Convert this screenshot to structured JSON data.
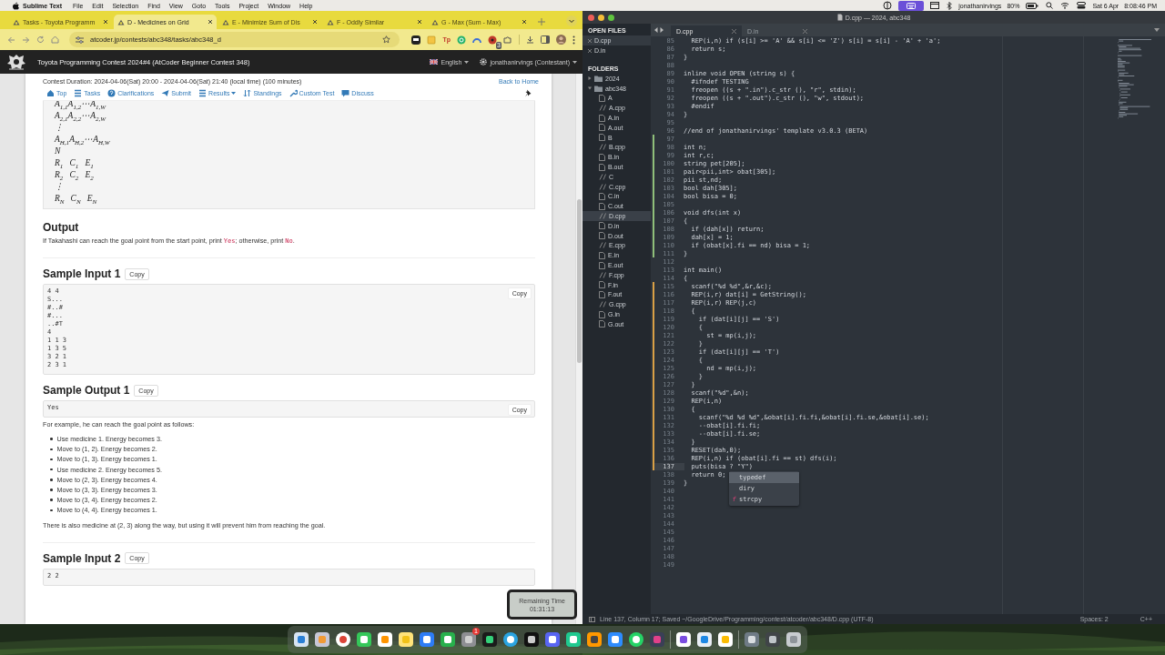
{
  "menubar": {
    "app": "Sublime Text",
    "menus": [
      "File",
      "Edit",
      "Selection",
      "Find",
      "View",
      "Goto",
      "Tools",
      "Project",
      "Window",
      "Help"
    ],
    "user": "jonathanirvings",
    "battery": "80%",
    "date": "Sat 6 Apr",
    "time": "8:08:46 PM"
  },
  "browser": {
    "tabs": [
      {
        "title": "Tasks - Toyota Programm",
        "selected": false
      },
      {
        "title": "D - Medicines on Grid",
        "selected": true
      },
      {
        "title": "E - Minimize Sum of Dis",
        "selected": false
      },
      {
        "title": "F - Oddly Similar",
        "selected": false
      },
      {
        "title": "G - Max (Sum - Max)",
        "selected": false
      }
    ],
    "url": "atcoder.jp/contests/abc348/tasks/abc348_d",
    "extension_label": "Tp",
    "extension_badge": "3",
    "site": {
      "title": "Toyota Programming Contest 2024#4 (AtCoder Beginner Contest 348)",
      "language": "English",
      "user": "jonathanirvings (Contestant)"
    },
    "contest_duration": "Contest Duration: 2024-04-06(Sat) 20:00 - 2024-04-06(Sat) 21:40 (local time) (100 minutes)",
    "back_link": "Back to Home",
    "nav": [
      {
        "label": "Top",
        "kind": "home",
        "dropdown": false
      },
      {
        "label": "Tasks",
        "kind": "list",
        "dropdown": false
      },
      {
        "label": "Clarifications",
        "kind": "question",
        "dropdown": false
      },
      {
        "label": "Submit",
        "kind": "send",
        "dropdown": false
      },
      {
        "label": "Results",
        "kind": "list",
        "dropdown": true
      },
      {
        "label": "Standings",
        "kind": "sort",
        "dropdown": false
      },
      {
        "label": "Custom Test",
        "kind": "wrench",
        "dropdown": false
      },
      {
        "label": "Discuss",
        "kind": "comment",
        "dropdown": false
      }
    ],
    "input_format": [
      "A$_{1,1}$A$_{1,2}$⋯A$_{1,W}$",
      "A$_{2,1}$A$_{2,2}$⋯A$_{2,W}$",
      "⋮",
      "A$_{H,1}$A$_{H,2}$⋯A$_{H,W}$",
      "N",
      "R$_{1}$   C$_{1}$   E$_{1}$",
      "R$_{2}$   C$_{2}$   E$_{2}$",
      "⋮",
      "R$_{N}$   C$_{N}$   E$_{N}$"
    ],
    "sections": [
      {
        "kind": "heading",
        "text": "Output"
      },
      {
        "kind": "paragraph",
        "segments": [
          {
            "text": "If Takahashi can reach the goal point from the start point, print "
          },
          {
            "text": "Yes",
            "kind": "code"
          },
          {
            "text": "; otherwise, print "
          },
          {
            "text": "No",
            "kind": "code"
          },
          {
            "text": "."
          }
        ]
      },
      {
        "kind": "rule"
      },
      {
        "kind": "sample",
        "title": "Sample Input 1",
        "copy": "Copy",
        "box_copy": "Copy",
        "lines": [
          "4 4",
          "S...",
          "#..#",
          "#...",
          "..#T",
          "4",
          "1 1 3",
          "1 3 5",
          "3 2 1",
          "2 3 1"
        ]
      },
      {
        "kind": "sample",
        "title": "Sample Output 1",
        "copy": "Copy",
        "box_copy": "Copy",
        "lines": [
          "Yes"
        ]
      },
      {
        "kind": "paragraph",
        "segments": [
          {
            "text": "For example, he can reach the goal point as follows:"
          }
        ]
      },
      {
        "kind": "list",
        "items": [
          "Use medicine 1. Energy becomes 3.",
          "Move to (1, 2). Energy becomes 2.",
          "Move to (1, 3). Energy becomes 1.",
          "Use medicine 2. Energy becomes 5.",
          "Move to (2, 3). Energy becomes 4.",
          "Move to (3, 3). Energy becomes 3.",
          "Move to (3, 4). Energy becomes 2.",
          "Move to (4, 4). Energy becomes 1."
        ]
      },
      {
        "kind": "paragraph",
        "segments": [
          {
            "text": "There is also medicine at (2, 3) along the way, but using it will prevent him from reaching the goal."
          }
        ]
      },
      {
        "kind": "rule"
      },
      {
        "kind": "sample",
        "title": "Sample Input 2",
        "copy": "Copy",
        "lines": [
          "2 2"
        ]
      }
    ]
  },
  "timer": {
    "label": "Remaining Time",
    "value": "01:31:13"
  },
  "editor": {
    "title": "D.cpp — 2024, abc348",
    "open_files_header": "OPEN FILES",
    "folders_header": "FOLDERS",
    "open_files": [
      {
        "name": "D.cpp",
        "selected": true
      },
      {
        "name": "D.in",
        "selected": false
      }
    ],
    "folders": [
      {
        "name": "2024",
        "expanded": false
      },
      {
        "name": "abc348",
        "expanded": true,
        "children": [
          {
            "name": "A",
            "kind": "file",
            "selected": false
          },
          {
            "name": "A.cpp",
            "kind": "source",
            "selected": false
          },
          {
            "name": "A.in",
            "kind": "file",
            "selected": false
          },
          {
            "name": "A.out",
            "kind": "file",
            "selected": false
          },
          {
            "name": "B",
            "kind": "file",
            "selected": false
          },
          {
            "name": "B.cpp",
            "kind": "source",
            "selected": false
          },
          {
            "name": "B.in",
            "kind": "file",
            "selected": false
          },
          {
            "name": "B.out",
            "kind": "file",
            "selected": false
          },
          {
            "name": "C",
            "kind": "source",
            "selected": false
          },
          {
            "name": "C.cpp",
            "kind": "source",
            "selected": false
          },
          {
            "name": "C.in",
            "kind": "file",
            "selected": false
          },
          {
            "name": "C.out",
            "kind": "file",
            "selected": false
          },
          {
            "name": "D.cpp",
            "kind": "source",
            "selected": true
          },
          {
            "name": "D.in",
            "kind": "file",
            "selected": false
          },
          {
            "name": "D.out",
            "kind": "file",
            "selected": false
          },
          {
            "name": "E.cpp",
            "kind": "source",
            "selected": false
          },
          {
            "name": "E.in",
            "kind": "file",
            "selected": false
          },
          {
            "name": "E.out",
            "kind": "file",
            "selected": false
          },
          {
            "name": "F.cpp",
            "kind": "source",
            "selected": false
          },
          {
            "name": "F.in",
            "kind": "file",
            "selected": false
          },
          {
            "name": "F.out",
            "kind": "file",
            "selected": false
          },
          {
            "name": "G.cpp",
            "kind": "source",
            "selected": false
          },
          {
            "name": "G.in",
            "kind": "file",
            "selected": false
          },
          {
            "name": "G.out",
            "kind": "file",
            "selected": false
          }
        ]
      }
    ],
    "tabs": [
      {
        "name": "D.cpp",
        "selected": true
      },
      {
        "name": "D.in",
        "selected": false
      }
    ],
    "lines": [
      {
        "n": "85",
        "text": "  REP(i,n) if (s[i] >= 'A' && s[i] <= 'Z') s[i] = s[i] - 'A' + 'a';",
        "current": false
      },
      {
        "n": "86",
        "text": "  return s;",
        "current": false
      },
      {
        "n": "87",
        "text": "}",
        "current": false
      },
      {
        "n": "88",
        "current": false
      },
      {
        "n": "89",
        "text": "inline void OPEN (string s) {",
        "current": false
      },
      {
        "n": "90",
        "text": "  #ifndef TESTING",
        "current": false
      },
      {
        "n": "91",
        "text": "  freopen ((s + \".in\").c_str (), \"r\", stdin);",
        "current": false
      },
      {
        "n": "92",
        "text": "  freopen ((s + \".out\").c_str (), \"w\", stdout);",
        "current": false
      },
      {
        "n": "93",
        "text": "  #endif",
        "current": false
      },
      {
        "n": "94",
        "text": "}",
        "current": false
      },
      {
        "n": "95",
        "current": false
      },
      {
        "n": "96",
        "text": "//end of jonathanirvings' template v3.0.3 (BETA)",
        "current": false
      },
      {
        "n": "97",
        "current": false,
        "color": "#8fbf7a"
      },
      {
        "n": "98",
        "text": "int n;",
        "current": false,
        "color": "#8fbf7a"
      },
      {
        "n": "99",
        "text": "int r,c;",
        "current": false,
        "color": "#8fbf7a"
      },
      {
        "n": "100",
        "text": "string pet[205];",
        "current": false,
        "color": "#8fbf7a"
      },
      {
        "n": "101",
        "text": "pair<pii,int> obat[305];",
        "current": false,
        "color": "#8fbf7a"
      },
      {
        "n": "102",
        "text": "pii st,nd;",
        "current": false,
        "color": "#8fbf7a"
      },
      {
        "n": "103",
        "text": "bool dah[305];",
        "current": false,
        "color": "#8fbf7a"
      },
      {
        "n": "104",
        "text": "bool bisa = 0;",
        "current": false,
        "color": "#8fbf7a"
      },
      {
        "n": "105",
        "current": false,
        "color": "#8fbf7a"
      },
      {
        "n": "106",
        "text": "void dfs(int x)",
        "current": false,
        "color": "#8fbf7a"
      },
      {
        "n": "107",
        "text": "{",
        "current": false,
        "color": "#8fbf7a"
      },
      {
        "n": "108",
        "text": "  if (dah[x]) return;",
        "current": false,
        "color": "#8fbf7a"
      },
      {
        "n": "109",
        "text": "  dah[x] = 1;",
        "current": false,
        "color": "#8fbf7a"
      },
      {
        "n": "110",
        "text": "  if (obat[x].fi == nd) bisa = 1;",
        "current": false,
        "color": "#8fbf7a"
      },
      {
        "n": "111",
        "text": "}",
        "current": false,
        "color": "#8fbf7a"
      },
      {
        "n": "112",
        "current": false
      },
      {
        "n": "113",
        "text": "int main()",
        "current": false
      },
      {
        "n": "114",
        "text": "{",
        "current": false
      },
      {
        "n": "115",
        "text": "  scanf(\"%d %d\",&r,&c);",
        "current": false,
        "color": "#d9a046"
      },
      {
        "n": "116",
        "text": "  REP(i,r) dat[i] = GetString();",
        "current": false,
        "color": "#d9a046"
      },
      {
        "n": "117",
        "text": "  REP(i,r) REP(j,c)",
        "current": false,
        "color": "#d9a046"
      },
      {
        "n": "118",
        "text": "  {",
        "current": false,
        "color": "#d9a046"
      },
      {
        "n": "119",
        "text": "    if (dat[i][j] == 'S')",
        "current": false,
        "color": "#d9a046"
      },
      {
        "n": "120",
        "text": "    {",
        "current": false,
        "color": "#d9a046"
      },
      {
        "n": "121",
        "text": "      st = mp(i,j);",
        "current": false,
        "color": "#d9a046"
      },
      {
        "n": "122",
        "text": "    }",
        "current": false,
        "color": "#d9a046"
      },
      {
        "n": "123",
        "text": "    if (dat[i][j] == 'T')",
        "current": false,
        "color": "#d9a046"
      },
      {
        "n": "124",
        "text": "    {",
        "current": false,
        "color": "#d9a046"
      },
      {
        "n": "125",
        "text": "      nd = mp(i,j);",
        "current": false,
        "color": "#d9a046"
      },
      {
        "n": "126",
        "text": "    }",
        "current": false,
        "color": "#d9a046"
      },
      {
        "n": "127",
        "text": "  }",
        "current": false,
        "color": "#d9a046"
      },
      {
        "n": "128",
        "text": "  scanf(\"%d\",&n);",
        "current": false,
        "color": "#d9a046"
      },
      {
        "n": "129",
        "text": "  REP(i,n)",
        "current": false,
        "color": "#d9a046"
      },
      {
        "n": "130",
        "text": "  {",
        "current": false,
        "color": "#d9a046"
      },
      {
        "n": "131",
        "text": "    scanf(\"%d %d %d\",&obat[i].fi.fi,&obat[i].fi.se,&obat[i].se);",
        "current": false,
        "color": "#d9a046"
      },
      {
        "n": "132",
        "text": "    --obat[i].fi.fi;",
        "current": false,
        "color": "#d9a046"
      },
      {
        "n": "133",
        "text": "    --obat[i].fi.se;",
        "current": false,
        "color": "#d9a046"
      },
      {
        "n": "134",
        "text": "  }",
        "current": false,
        "color": "#d9a046"
      },
      {
        "n": "135",
        "text": "  RESET(dah,0);",
        "current": false,
        "color": "#d9a046"
      },
      {
        "n": "136",
        "text": "  REP(i,n) if (obat[i].fi == st) dfs(i);",
        "current": false,
        "color": "#d9a046"
      },
      {
        "n": "137",
        "text": "  puts(bisa ? \"Y\")",
        "current": true,
        "color": "#d9a046"
      },
      {
        "n": "138",
        "text": "  return 0;",
        "current": false
      },
      {
        "n": "139",
        "text": "}",
        "current": false
      },
      {
        "n": "140",
        "current": false
      },
      {
        "n": "141",
        "current": false
      },
      {
        "n": "142",
        "current": false
      },
      {
        "n": "143",
        "current": false
      },
      {
        "n": "144",
        "current": false
      },
      {
        "n": "145",
        "current": false
      },
      {
        "n": "146",
        "current": false
      },
      {
        "n": "147",
        "current": false
      },
      {
        "n": "148",
        "current": false
      },
      {
        "n": "149",
        "current": false
      }
    ],
    "autocomplete": [
      {
        "label": "typedef",
        "selected": true
      },
      {
        "label": "diry",
        "selected": false
      },
      {
        "label": "strcpy",
        "selected": false,
        "glyph": "f"
      }
    ],
    "status": {
      "text": "Line 137, Column 17; Saved ~/GoogleDrive/Programming/contest/atcoder/abc348/D.cpp (UTF-8)",
      "indent": "Spaces: 2",
      "syntax": "C++"
    }
  },
  "dock": {
    "badge": "1"
  }
}
